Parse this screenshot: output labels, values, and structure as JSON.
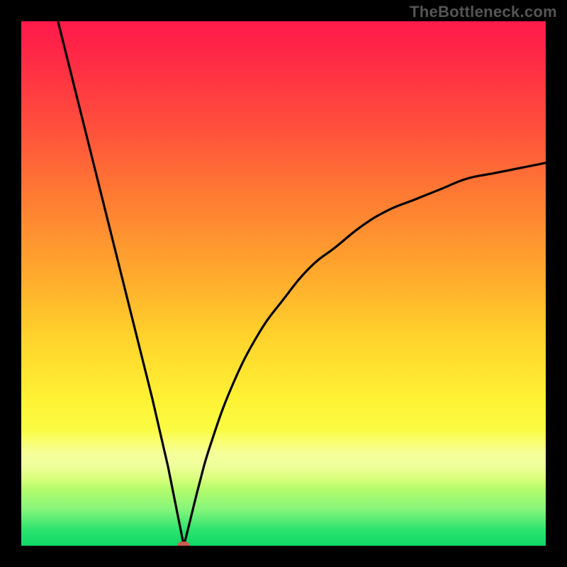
{
  "watermark": "TheBottleneck.com",
  "colors": {
    "black": "#000000",
    "curve": "#000000",
    "marker": "#ca5a4f",
    "watermark_text": "#555555"
  },
  "chart_data": {
    "type": "line",
    "title": "",
    "xlabel": "",
    "ylabel": "",
    "xlim": [
      0,
      100
    ],
    "ylim": [
      0,
      100
    ],
    "grid": false,
    "legend": false,
    "notes": "V-shaped bottleneck curve on a vertical red→green gradient. Minimum reaches 0 (green) near x≈31. Left branch starts near 100 at x≈7 and descends almost linearly to the minimum. Right branch rises with decreasing slope toward ~73 at x=100.",
    "series": [
      {
        "name": "bottleneck-curve",
        "x": [
          7,
          10,
          15,
          20,
          25,
          28,
          30,
          31,
          32,
          34,
          36,
          40,
          45,
          50,
          55,
          60,
          65,
          70,
          75,
          80,
          85,
          90,
          95,
          100
        ],
        "values": [
          100,
          88,
          68,
          48,
          28,
          15,
          5,
          0,
          4,
          12,
          19,
          30,
          40,
          47,
          53,
          57,
          61,
          64,
          66,
          68,
          70,
          71,
          72,
          73
        ]
      }
    ],
    "marker": {
      "x": 31,
      "y": 0
    }
  }
}
